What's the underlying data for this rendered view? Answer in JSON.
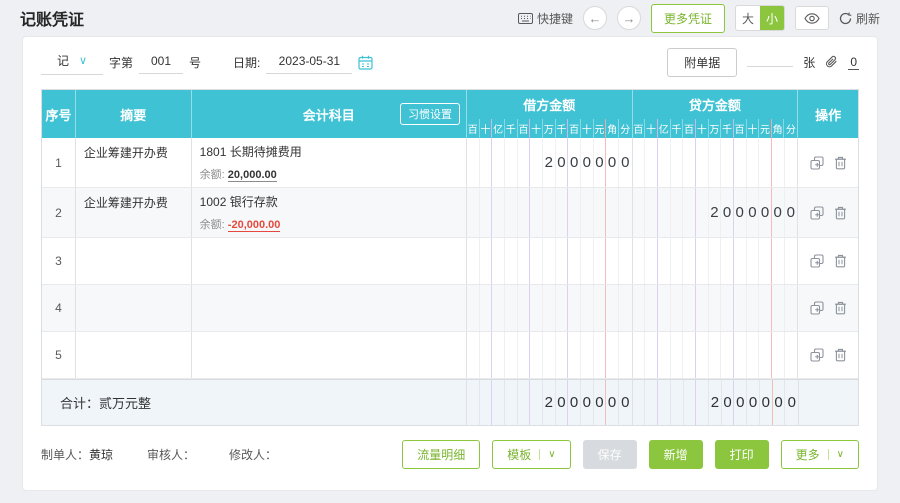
{
  "colors": {
    "accent_teal": "#3ec2d4",
    "accent_green": "#8cc63f",
    "negative_red": "#e5493d"
  },
  "icons": {
    "prev": "←",
    "next": "→",
    "chevron_down": "∨"
  },
  "topbar": {
    "title": "记账凭证",
    "shortcut": "快捷键",
    "more_vouchers": "更多凭证",
    "size_large": "大",
    "size_small": "小",
    "refresh": "刷新"
  },
  "voucher": {
    "type": "记",
    "zi_label": "字第",
    "number": "001",
    "hao_label": "号",
    "date_label": "日期:",
    "date": "2023-05-31",
    "attach_button": "附单据",
    "attach_unit": "张",
    "attach_count": "0"
  },
  "table": {
    "col_seq": "序号",
    "col_summary": "摘要",
    "col_subject": "会计科目",
    "habit_button": "习惯设置",
    "col_debit": "借方金额",
    "col_credit": "贷方金额",
    "col_ops": "操作",
    "digit_labels": [
      "百",
      "十",
      "亿",
      "千",
      "百",
      "十",
      "万",
      "千",
      "百",
      "十",
      "元",
      "角",
      "分"
    ],
    "rows": [
      {
        "seq": "1",
        "summary": "企业筹建开办费",
        "subject": "1801 长期待摊费用",
        "balance_label": "余额: ",
        "balance": "20,000.00",
        "balance_negative": "false",
        "debit_digits": [
          "",
          "",
          "",
          "",
          "",
          "",
          "2",
          "0",
          "0",
          "0",
          "0",
          "0",
          "0"
        ],
        "credit_digits": []
      },
      {
        "seq": "2",
        "summary": "企业筹建开办费",
        "subject": "1002 银行存款",
        "balance_label": "余额: ",
        "balance": "-20,000.00",
        "balance_negative": "true",
        "debit_digits": [],
        "credit_digits": [
          "",
          "",
          "",
          "",
          "",
          "",
          "2",
          "0",
          "0",
          "0",
          "0",
          "0",
          "0"
        ]
      },
      {
        "seq": "3",
        "summary": "",
        "subject": "",
        "balance_label": "",
        "balance": "",
        "balance_negative": "false",
        "debit_digits": [],
        "credit_digits": []
      },
      {
        "seq": "4",
        "summary": "",
        "subject": "",
        "balance_label": "",
        "balance": "",
        "balance_negative": "false",
        "debit_digits": [],
        "credit_digits": []
      },
      {
        "seq": "5",
        "summary": "",
        "subject": "",
        "balance_label": "",
        "balance": "",
        "balance_negative": "false",
        "debit_digits": [],
        "credit_digits": []
      }
    ],
    "total": {
      "label": "合计：贰万元整",
      "debit_digits": [
        "",
        "",
        "",
        "",
        "",
        "",
        "2",
        "0",
        "0",
        "0",
        "0",
        "0",
        "0"
      ],
      "credit_digits": [
        "",
        "",
        "",
        "",
        "",
        "",
        "2",
        "0",
        "0",
        "0",
        "0",
        "0",
        "0"
      ]
    }
  },
  "footer": {
    "maker_label": "制单人：",
    "maker_value": "黄琼",
    "auditor_label": "审核人：",
    "auditor_value": "",
    "modifier_label": "修改人：",
    "modifier_value": "",
    "flow_button": "流量明细",
    "template_button": "模板",
    "save_button": "保存",
    "add_button": "新增",
    "print_button": "打印",
    "more_button": "更多"
  }
}
